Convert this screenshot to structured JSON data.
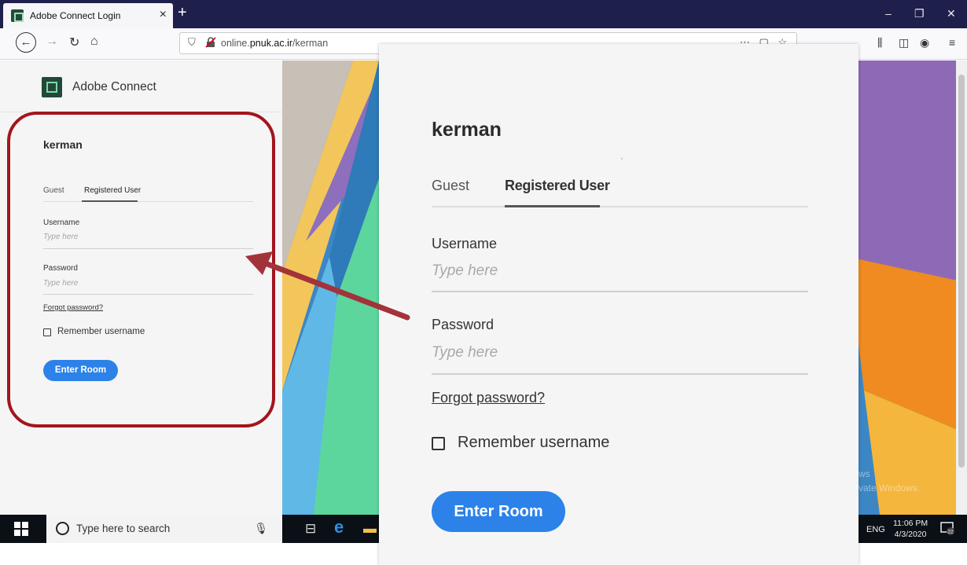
{
  "browser": {
    "tab_title": "Adobe Connect Login",
    "tab_close": "×",
    "new_tab": "+",
    "url_prefix": "online.",
    "url_domain": "pnuk.ac.ir",
    "url_path": "/kerman",
    "url_actions": "⋯ ▢ ☆",
    "window_controls": {
      "minimize": "–",
      "restore": "❐",
      "close": "✕"
    },
    "toolbar_icons": [
      "library-icon",
      "sidebar-icon",
      "account-icon",
      "menu-icon"
    ]
  },
  "app": {
    "brand_name": "Adobe Connect"
  },
  "login": {
    "room_name": "kerman",
    "tabs": [
      {
        "label": "Guest",
        "active": false
      },
      {
        "label": "Registered User",
        "active": true
      }
    ],
    "username_label": "Username",
    "username_placeholder": "Type here",
    "password_label": "Password",
    "password_placeholder": "Type here",
    "forgot_password": "Forgot password?",
    "remember_label": "Remember username",
    "remember_checked": false,
    "enter_button": "Enter Room"
  },
  "taskbar": {
    "search_placeholder": "Type here to search",
    "language": "ENG",
    "time": "11:06 PM",
    "date": "4/3/2020",
    "notification_count": "22"
  },
  "watermark": {
    "line1": "ws",
    "line2": "vate Windows."
  },
  "colors": {
    "accent": "#2c82e8",
    "highlight_ring": "#a3151c",
    "arrow": "#a3333a",
    "titlebar": "#1f1f4c"
  }
}
